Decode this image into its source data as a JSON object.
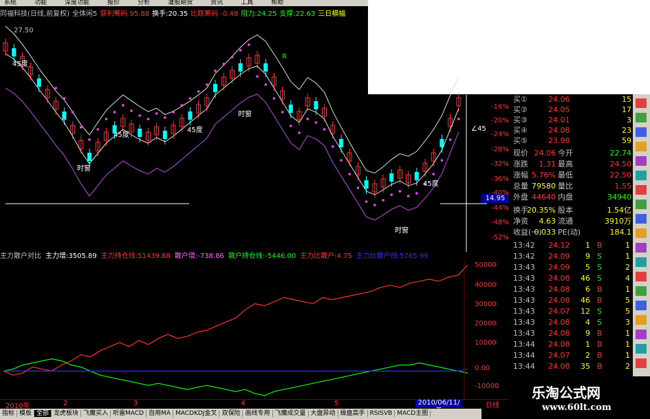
{
  "menu": [
    "系统",
    "功能",
    "深度功能",
    "报价",
    "分析",
    "灌股期货",
    "资讯",
    "工具",
    "帮助"
  ],
  "info_line": [
    {
      "text": "同福科技(日线,前复权)",
      "color": "#c0c0c0"
    },
    {
      "text": "全体闲5",
      "color": "#c0c0c0"
    },
    {
      "text": "获利筹码 95.88",
      "color": "#ff3030"
    },
    {
      "text": "换手:20.35",
      "color": "#ffffff"
    },
    {
      "text": "比跌筹码 -0.48",
      "color": "#ff3030"
    },
    {
      "text": "阻力:24.25",
      "color": "#00ff00"
    },
    {
      "text": "支撑:22.63",
      "color": "#00ff00"
    },
    {
      "text": "三日横幅",
      "color": "#ffff00"
    }
  ],
  "chart_labels": {
    "top_price": "27.50",
    "price_tag": "14.95",
    "deg45": "45度",
    "shichuang": "时窗",
    "deg45_right": "∠45",
    "r_mark": "R"
  },
  "pct_axis": [
    "-16%",
    "-20%",
    "-24%",
    "-28%",
    "-32%",
    "-36%",
    "-40%",
    "-44%",
    "-48%",
    "-52%"
  ],
  "sub_header": [
    {
      "text": "主力散户对比",
      "color": "#c0c0c0"
    },
    {
      "text": "主力增:3505.89",
      "color": "#ffffff"
    },
    {
      "text": "主力持仓线:51439.88",
      "color": "#ff3030"
    },
    {
      "text": "散户增:-738.86",
      "color": "#ff66ff"
    },
    {
      "text": "散户持仓线:-5446.00",
      "color": "#00ff00"
    },
    {
      "text": "主力比散户:4.75",
      "color": "#ff3030"
    },
    {
      "text": "主力比散户线:5765.99",
      "color": "#3030ff"
    }
  ],
  "sub_axis": [
    "50000",
    "40000",
    "30000",
    "20000",
    "10000",
    "0.00",
    "-10000"
  ],
  "x_axis": {
    "labels": [
      "2010年",
      "2",
      "3",
      "4",
      "5"
    ],
    "date": "2010/06/11/五",
    "period": "日线"
  },
  "tabs": [
    "指标",
    "模板",
    "全部",
    "龙虎板块",
    "飞魔买入",
    "听雷MACD",
    "自用MA",
    "MACDKDJ金叉",
    "双保险",
    "画线专用",
    "飞魔成交量",
    "大盘异动",
    "操盘高手",
    "RSISVB",
    "MACD主图"
  ],
  "order_book": [
    {
      "label": "买①",
      "price": "24.06",
      "vol": "15"
    },
    {
      "label": "买②",
      "price": "24.05",
      "vol": "17"
    },
    {
      "label": "买③",
      "price": "24.01",
      "vol": "3"
    },
    {
      "label": "买④",
      "price": "24.08",
      "vol": "23"
    },
    {
      "label": "买⑤",
      "price": "23.98",
      "vol": "59"
    }
  ],
  "quote": [
    {
      "k1": "现价",
      "v1": "24.06",
      "k2": "今开",
      "v2": "22.74"
    },
    {
      "k1": "涨跌",
      "v1": "1.31",
      "k2": "最高",
      "v2": "24.50"
    },
    {
      "k1": "涨幅",
      "v1": "5.76%",
      "k2": "最低",
      "v2": "22.50"
    },
    {
      "k1": "总量",
      "v1": "79580",
      "k2": "量比",
      "v2": "1.55"
    },
    {
      "k1": "外盘",
      "v1": "44640",
      "k2": "内盘",
      "v2": "34940"
    },
    {
      "k1": "换手",
      "v1": "20.35%",
      "k2": "股本",
      "v2": "1.54亿"
    },
    {
      "k1": "净资",
      "v1": "4.63",
      "k2": "流通",
      "v2": "3910万"
    },
    {
      "k1": "收益(一)",
      "v1": "0.033",
      "k2": "PE(动)",
      "v2": "184.1"
    }
  ],
  "ticks": [
    {
      "time": "13:42",
      "price": "24.12",
      "vol": "1",
      "side": "B",
      "n": "1"
    },
    {
      "time": "13:42",
      "price": "24.09",
      "vol": "9",
      "side": "S",
      "n": "1"
    },
    {
      "time": "13:43",
      "price": "24.09",
      "vol": "5",
      "side": "S",
      "n": "2"
    },
    {
      "time": "13:43",
      "price": "24.08",
      "vol": "46",
      "side": "S",
      "n": "4"
    },
    {
      "time": "13:43",
      "price": "24.08",
      "vol": "6",
      "side": "B",
      "n": "1"
    },
    {
      "time": "13:43",
      "price": "24.08",
      "vol": "46",
      "side": "B",
      "n": "5"
    },
    {
      "time": "13:43",
      "price": "24.07",
      "vol": "12",
      "side": "S",
      "n": "5"
    },
    {
      "time": "13:43",
      "price": "24.08",
      "vol": "4",
      "side": "S",
      "n": "3"
    },
    {
      "time": "13:43",
      "price": "24.08",
      "vol": "9",
      "side": "B",
      "n": "1"
    },
    {
      "time": "13:44",
      "price": "24.08",
      "vol": "1",
      "side": "B",
      "n": "1"
    },
    {
      "time": "13:44",
      "price": "24.07",
      "vol": "2",
      "side": "B",
      "n": "1"
    },
    {
      "time": "13:44",
      "price": "24.08",
      "vol": "35",
      "side": "B",
      "n": "2"
    }
  ],
  "brand": {
    "name": "乐淘公式网",
    "url": "www.60lt.com"
  },
  "colors": {
    "up": "#ff3030",
    "down": "#00ffff",
    "ma": "#e0e0e0",
    "purple": "#a040c0",
    "dots": "#ff40ff",
    "green": "#00ff00",
    "blue": "#3030ff"
  },
  "chart_data": {
    "type": "line",
    "title": "主力散户对比",
    "series": [
      {
        "name": "主力持仓线",
        "color": "#ff3030",
        "values": [
          0,
          -2,
          -1,
          2,
          1,
          0,
          3,
          5,
          8,
          7,
          10,
          12,
          14,
          12,
          15,
          13,
          16,
          18,
          16,
          17,
          19,
          20,
          22,
          24,
          26,
          30,
          33,
          32,
          34,
          36,
          35,
          34,
          33,
          36,
          35,
          36,
          37,
          38,
          39,
          41,
          42,
          41,
          43,
          44,
          45,
          44,
          46,
          47,
          52
        ]
      },
      {
        "name": "散户持仓线",
        "color": "#00ff00",
        "values": [
          0,
          1,
          3,
          4,
          5,
          6,
          5,
          3,
          2,
          0,
          -2,
          -3,
          -4,
          -5,
          -6,
          -7,
          -6,
          -7,
          -8,
          -9,
          -8,
          -7,
          -8,
          -9,
          -10,
          -9,
          -11,
          -12,
          -10,
          -9,
          -8,
          -7,
          -6,
          -5,
          -4,
          -3,
          -2,
          -1,
          0,
          1,
          2,
          3,
          3,
          4,
          3,
          2,
          1,
          0,
          -1
        ]
      },
      {
        "name": "主力比散户线",
        "color": "#3030ff",
        "values": [
          0,
          0,
          0,
          0,
          0,
          0,
          0,
          0,
          0,
          0,
          0,
          0,
          0,
          0,
          0,
          0,
          0,
          0,
          0,
          0,
          0,
          0,
          0,
          0,
          0,
          0,
          0,
          0,
          0,
          0,
          0,
          0,
          0,
          0,
          0,
          0,
          0,
          0,
          0,
          0,
          0,
          0,
          0,
          0,
          0,
          0,
          0,
          0,
          1
        ]
      }
    ],
    "ylim": [
      -12,
      52
    ]
  }
}
